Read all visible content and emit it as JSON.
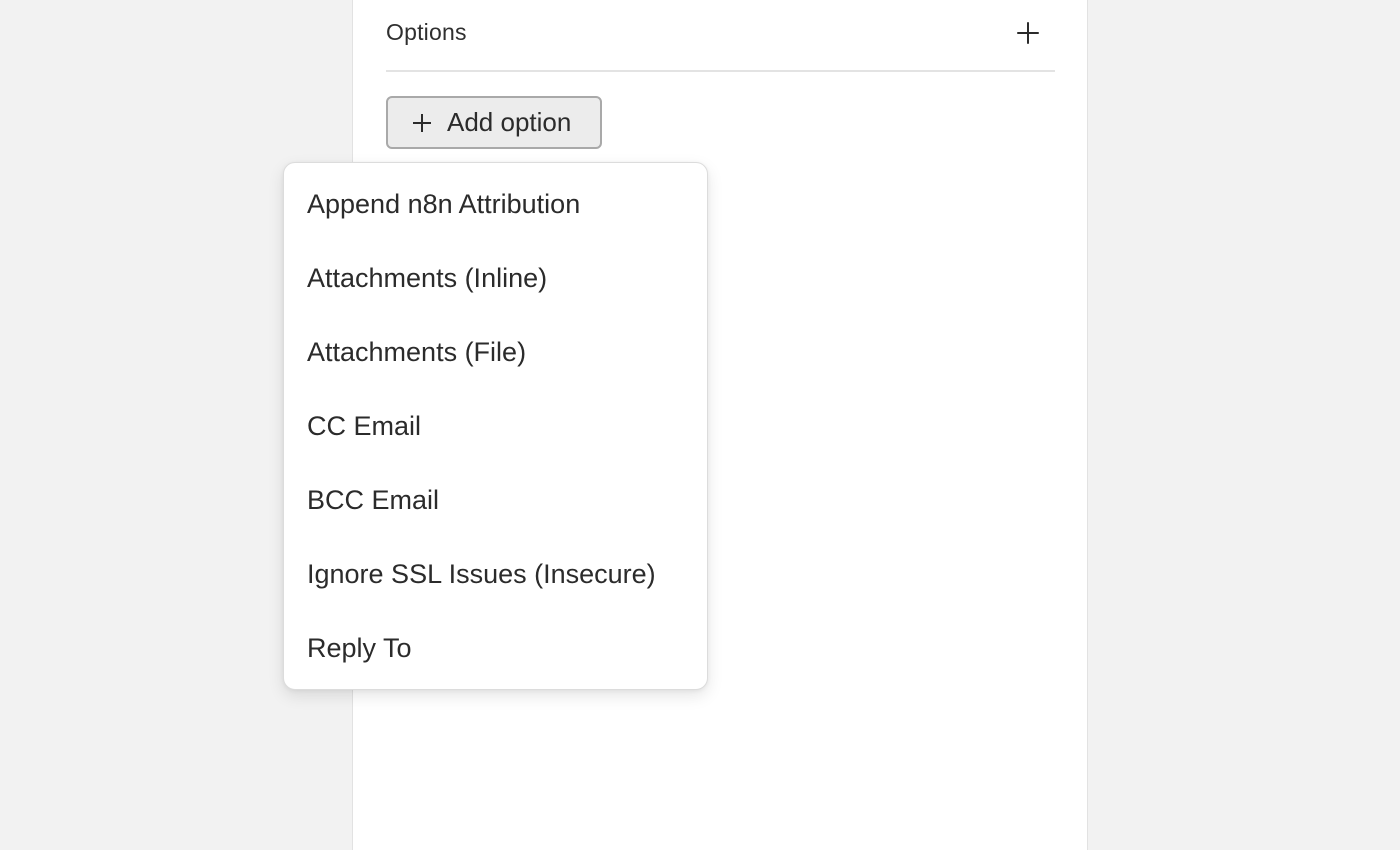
{
  "options": {
    "title": "Options",
    "add_icon": "plus-icon"
  },
  "add_option_button": {
    "icon": "plus-icon",
    "label": "Add option"
  },
  "dropdown": {
    "items": [
      {
        "label": "Append n8n Attribution"
      },
      {
        "label": "Attachments (Inline)"
      },
      {
        "label": "Attachments (File)"
      },
      {
        "label": "CC Email"
      },
      {
        "label": "BCC Email"
      },
      {
        "label": "Ignore SSL Issues (Insecure)"
      },
      {
        "label": "Reply To"
      }
    ]
  },
  "colors": {
    "page_background": "#f2f2f2",
    "panel_background": "#ffffff",
    "button_background": "#ececec",
    "button_border": "#a9a9a9",
    "text": "#2b2b2b"
  }
}
